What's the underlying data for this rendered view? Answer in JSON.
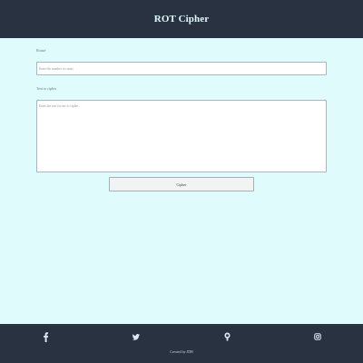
{
  "header": {
    "title": "ROT Cipher"
  },
  "form": {
    "rotate_label": "Rotate",
    "rotate_placeholder": "Enter the number to rotate",
    "text_label": "Text to cipher",
    "text_placeholder": "Enter the text for me to cipher...",
    "cipher_button_label": "Cipher"
  },
  "footer": {
    "icons": [
      "facebook-icon",
      "twitter-icon",
      "github-icon",
      "instagram-icon"
    ],
    "credit": "Created by JDB"
  },
  "colors": {
    "header_background": "#293241",
    "page_background": "#e0fbfc",
    "footer_background": "#293241",
    "header_text": "#e0fbfc"
  }
}
